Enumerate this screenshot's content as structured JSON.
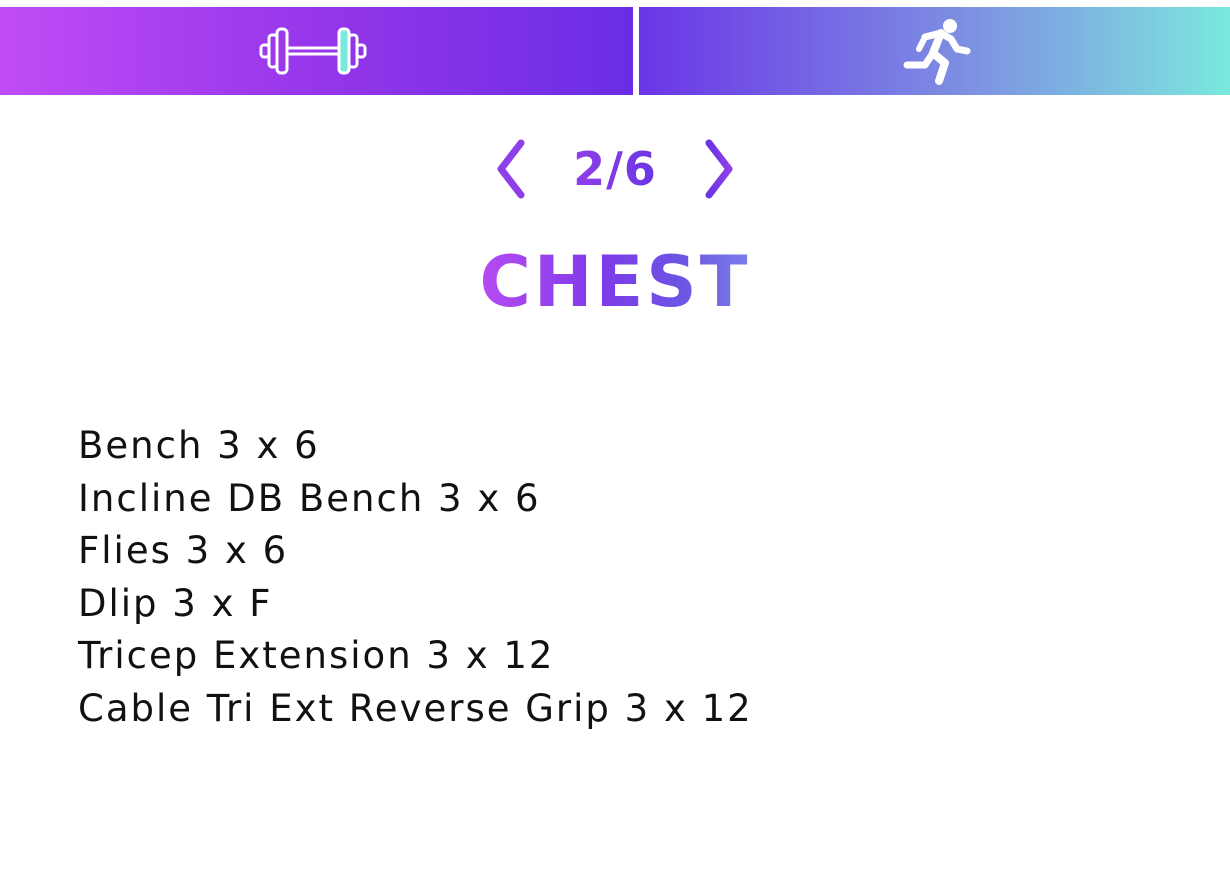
{
  "tabs": [
    {
      "id": "workout",
      "icon": "dumbbell-icon",
      "gradient": [
        "#c04cf6",
        "#6a2de4"
      ]
    },
    {
      "id": "cardio",
      "icon": "running-person-icon",
      "gradient": [
        "#6b35e6",
        "#7be8de"
      ]
    }
  ],
  "pager": {
    "current": 2,
    "total": 6,
    "label": "2/6",
    "prev_icon": "chevron-left-icon",
    "next_icon": "chevron-right-icon"
  },
  "workout": {
    "title": "CHEST",
    "exercises": [
      "Bench 3 x 6",
      "Incline DB Bench 3 x 6",
      "Flies 3 x 6",
      "Dlip 3 x F",
      "Tricep Extension 3 x 12",
      "Cable Tri Ext Reverse Grip 3 x 12"
    ]
  },
  "colors": {
    "accent_purple": "#8f3fe8",
    "accent_teal": "#7be8de",
    "text": "#111111"
  }
}
